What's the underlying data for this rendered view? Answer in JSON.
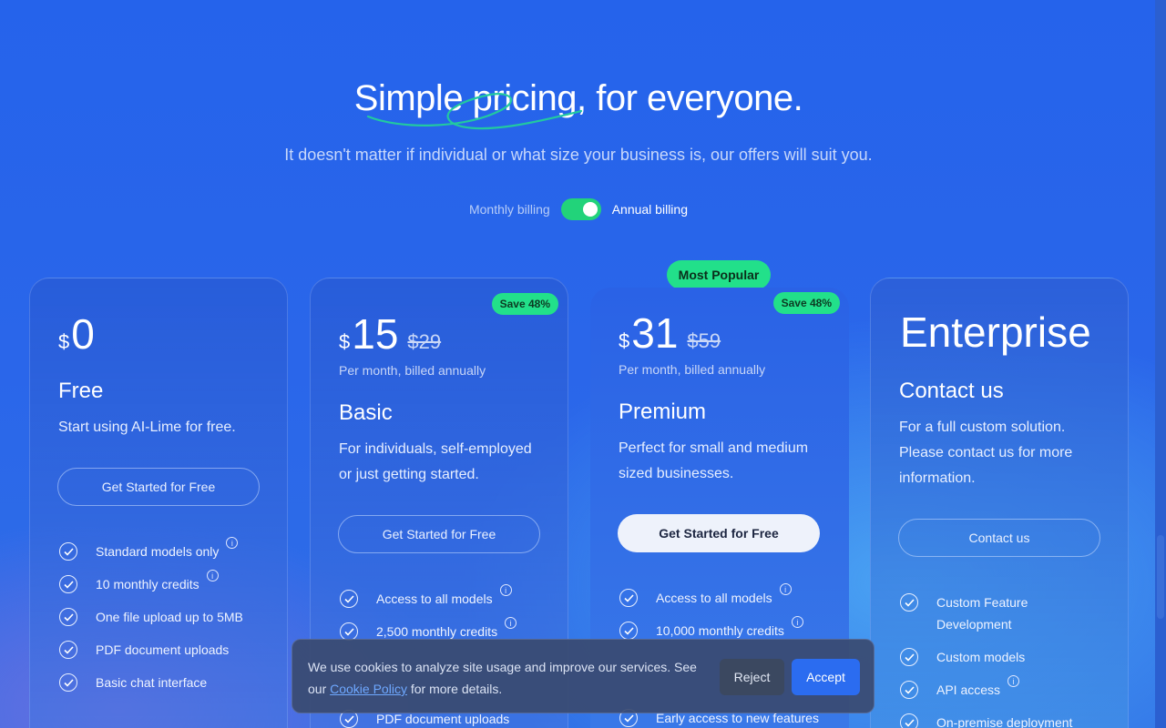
{
  "hero": {
    "title_highlight": "Simple pricing",
    "title_rest": ", for everyone.",
    "subtitle": "It doesn't matter if individual or what size your business is, our offers will suit you."
  },
  "billing": {
    "monthly_label": "Monthly billing",
    "annual_label": "Annual billing",
    "annual_selected": true
  },
  "popular_badge": "Most Popular",
  "plans": [
    {
      "currency": "$",
      "price": "0",
      "name": "Free",
      "description": "Start using AI-Lime for free.",
      "cta": "Get Started for Free",
      "features": [
        {
          "label": "Standard models only",
          "info": true
        },
        {
          "label": "10 monthly credits",
          "info": true
        },
        {
          "label": "One file upload up to 5MB",
          "info": false
        },
        {
          "label": "PDF document uploads",
          "info": false
        },
        {
          "label": "Basic chat interface",
          "info": false
        }
      ]
    },
    {
      "currency": "$",
      "price": "15",
      "old_price": "$29",
      "save": "Save 48%",
      "period": "Per month, billed annually",
      "name": "Basic",
      "description": "For individuals, self-employed or just getting started.",
      "cta": "Get Started for Free",
      "features": [
        {
          "label": "Access to all models",
          "info": true
        },
        {
          "label": "2,500 monthly credits",
          "info": true
        },
        {
          "label": "PDF document uploads",
          "info": false
        }
      ]
    },
    {
      "currency": "$",
      "price": "31",
      "old_price": "$59",
      "save": "Save 48%",
      "period": "Per month, billed annually",
      "name": "Premium",
      "description": "Perfect for small and medium sized businesses.",
      "cta": "Get Started for Free",
      "features": [
        {
          "label": "Access to all models",
          "info": true
        },
        {
          "label": "10,000 monthly credits",
          "info": true
        },
        {
          "label": "Early access to new features",
          "info": false
        }
      ]
    },
    {
      "title": "Enterprise",
      "name": "Contact us",
      "description": "For a full custom solution. Please contact us for more information.",
      "cta": "Contact us",
      "features": [
        {
          "label": "Custom Feature Development",
          "info": false
        },
        {
          "label": "Custom models",
          "info": false
        },
        {
          "label": "API access",
          "info": true
        },
        {
          "label": "On-premise deployment",
          "info": false
        }
      ]
    }
  ],
  "cookie": {
    "text": "We use cookies to analyze site usage and improve our services. See our",
    "link": "Cookie Policy",
    "text_after": " for more details.",
    "reject": "Reject",
    "accept": "Accept"
  },
  "icons": {
    "check": "check-circle-icon",
    "info": "info-icon"
  },
  "colors": {
    "accent_green": "#22e08a",
    "background_blue": "#2563eb"
  }
}
